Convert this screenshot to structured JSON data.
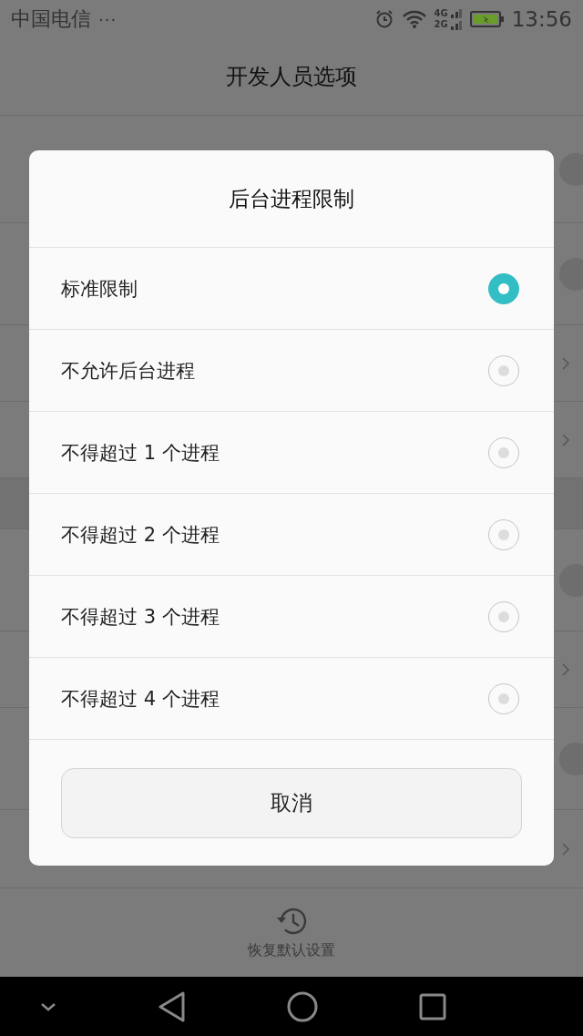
{
  "status_bar": {
    "carrier": "中国电信",
    "more": "···",
    "network_upper": "4G",
    "network_lower": "2G",
    "time": "13:56"
  },
  "header": {
    "title": "开发人员选项"
  },
  "background_rows": [
    {
      "kind": "toggle"
    },
    {
      "kind": "toggle"
    },
    {
      "kind": "chevron"
    },
    {
      "kind": "chevron"
    },
    {
      "kind": "gap"
    },
    {
      "kind": "toggle"
    },
    {
      "kind": "chevron"
    },
    {
      "kind": "toggle"
    },
    {
      "kind": "chevron"
    }
  ],
  "footer": {
    "label": "恢复默认设置"
  },
  "dialog": {
    "title": "后台进程限制",
    "options": [
      {
        "label": "标准限制",
        "selected": true
      },
      {
        "label": "不允许后台进程",
        "selected": false
      },
      {
        "label": "不得超过 1 个进程",
        "selected": false
      },
      {
        "label": "不得超过 2 个进程",
        "selected": false
      },
      {
        "label": "不得超过 3 个进程",
        "selected": false
      },
      {
        "label": "不得超过 4 个进程",
        "selected": false
      }
    ],
    "cancel": "取消"
  }
}
